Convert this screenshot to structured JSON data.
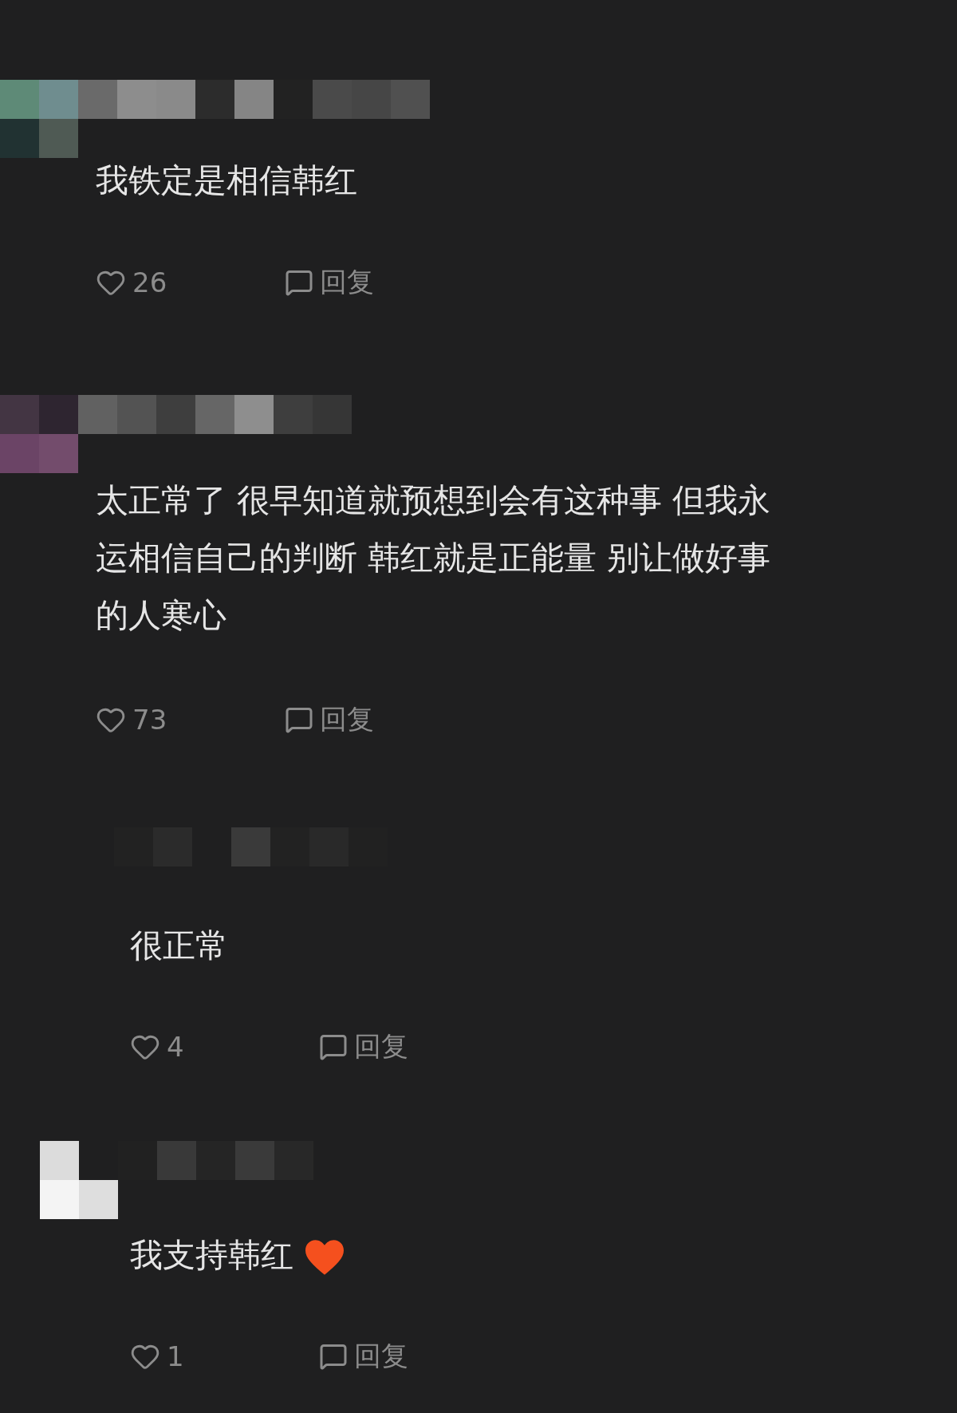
{
  "comments": [
    {
      "kind": "comment",
      "text": "我铁定是相信韩红",
      "likes": "26",
      "reply": "回复"
    },
    {
      "kind": "comment",
      "text": "太正常了 很早知道就预想到会有这种事 但我永运相信自己的判断 韩红就是正能量 别让做好事的人寒心",
      "likes": "73",
      "reply": "回复"
    },
    {
      "kind": "reply",
      "text": "很正常",
      "likes": "4",
      "reply": "回复"
    },
    {
      "kind": "reply",
      "text": "我支持韩红",
      "emoji": true,
      "likes": "1",
      "reply": "回复"
    }
  ]
}
